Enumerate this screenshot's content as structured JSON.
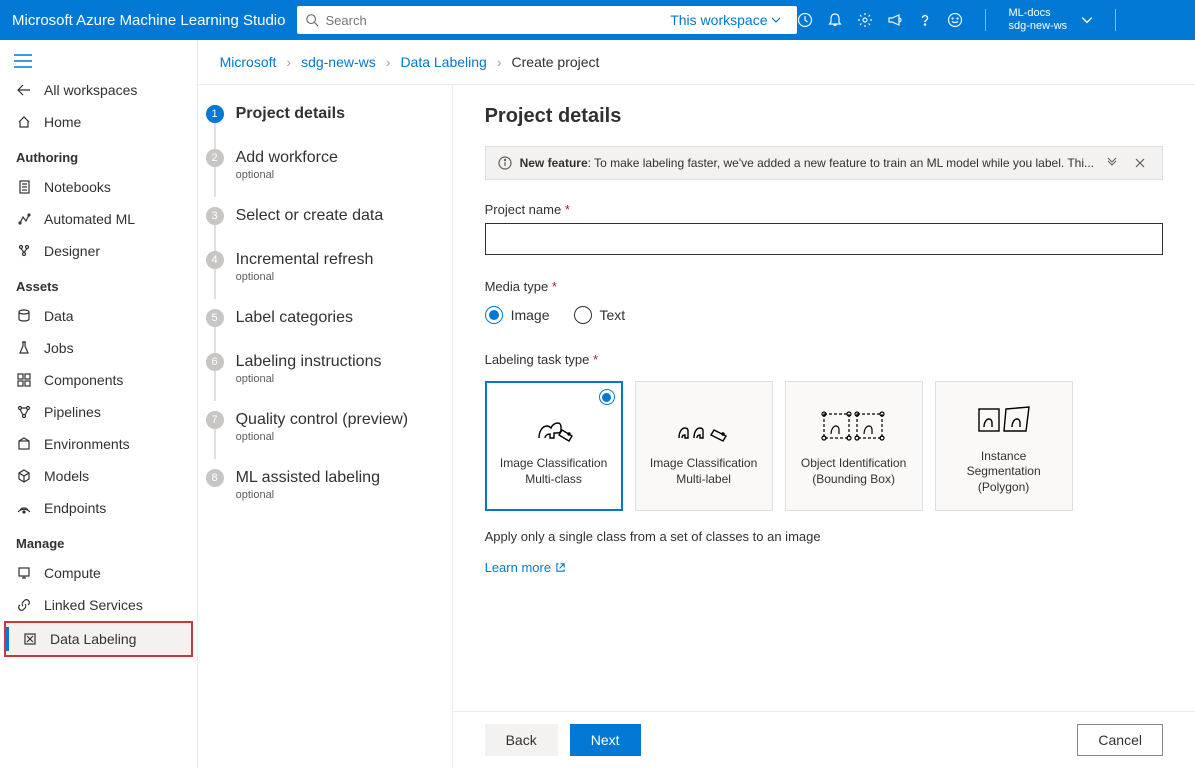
{
  "header": {
    "title": "Microsoft Azure Machine Learning Studio",
    "search_placeholder": "Search",
    "workspace_scope": "This workspace",
    "account_name": "ML-docs",
    "account_ws": "sdg-new-ws"
  },
  "sidebar": {
    "all_workspaces": "All workspaces",
    "home": "Home",
    "section_authoring": "Authoring",
    "notebooks": "Notebooks",
    "automated_ml": "Automated ML",
    "designer": "Designer",
    "section_assets": "Assets",
    "data": "Data",
    "jobs": "Jobs",
    "components": "Components",
    "pipelines": "Pipelines",
    "environments": "Environments",
    "models": "Models",
    "endpoints": "Endpoints",
    "section_manage": "Manage",
    "compute": "Compute",
    "linked_services": "Linked Services",
    "data_labeling": "Data Labeling"
  },
  "breadcrumb": {
    "root": "Microsoft",
    "ws": "sdg-new-ws",
    "feature": "Data Labeling",
    "current": "Create project"
  },
  "steps": [
    {
      "label": "Project details",
      "optional": false
    },
    {
      "label": "Add workforce",
      "optional": true
    },
    {
      "label": "Select or create data",
      "optional": false
    },
    {
      "label": "Incremental refresh",
      "optional": true
    },
    {
      "label": "Label categories",
      "optional": false
    },
    {
      "label": "Labeling instructions",
      "optional": true
    },
    {
      "label": "Quality control (preview)",
      "optional": true
    },
    {
      "label": "ML assisted labeling",
      "optional": true
    }
  ],
  "pane": {
    "title": "Project details",
    "info_prefix": "New feature",
    "info_text": ": To make labeling faster, we've added a new feature to train an ML model while you label. Thi...",
    "project_name_label": "Project name",
    "project_name_value": "",
    "media_type_label": "Media type",
    "media_options": {
      "image": "Image",
      "text": "Text"
    },
    "task_type_label": "Labeling task type",
    "tasks": [
      {
        "label": "Image Classification Multi-class"
      },
      {
        "label": "Image Classification Multi-label"
      },
      {
        "label": "Object Identification (Bounding Box)"
      },
      {
        "label": "Instance Segmentation (Polygon)"
      }
    ],
    "task_desc": "Apply only a single class from a set of classes to an image",
    "learn_more": "Learn more",
    "optional_text": "optional"
  },
  "footer": {
    "back": "Back",
    "next": "Next",
    "cancel": "Cancel"
  }
}
